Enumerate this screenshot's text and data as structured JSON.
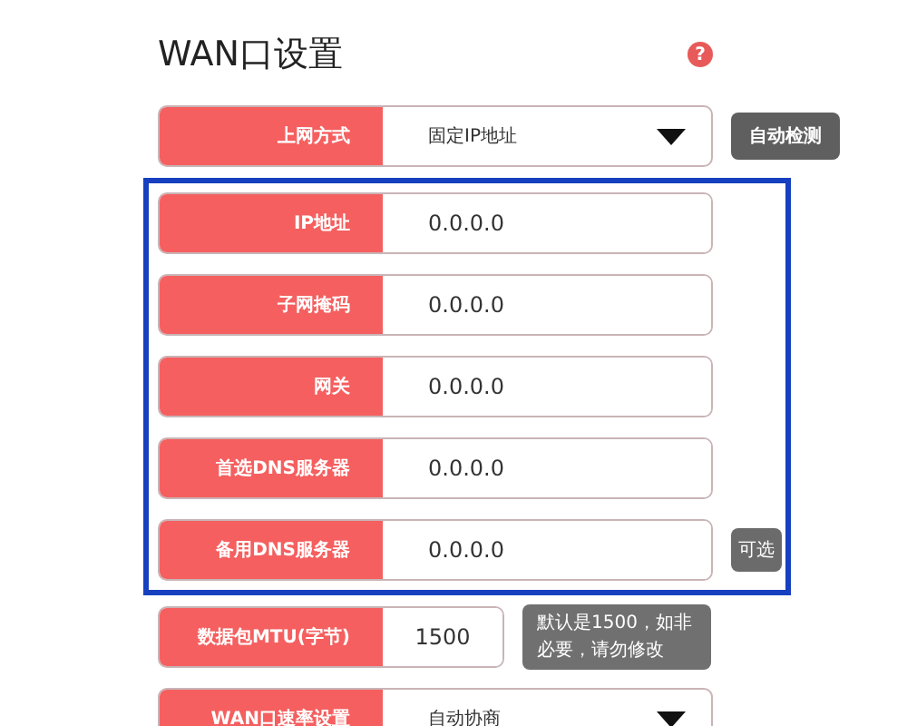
{
  "title": "WAN口设置",
  "help_icon": "?",
  "rows": [
    {
      "kind": "select",
      "label": "上网方式",
      "value": "固定IP地址",
      "action": "自动检测",
      "group": false
    },
    {
      "kind": "input",
      "label": "IP地址",
      "value": "0.0.0.0",
      "group": true
    },
    {
      "kind": "input",
      "label": "子网掩码",
      "value": "0.0.0.0",
      "group": true
    },
    {
      "kind": "input",
      "label": "网关",
      "value": "0.0.0.0",
      "group": true
    },
    {
      "kind": "input",
      "label": "首选DNS服务器",
      "value": "0.0.0.0",
      "group": true
    },
    {
      "kind": "input",
      "label": "备用DNS服务器",
      "value": "0.0.0.0",
      "note": "可选",
      "group": true
    },
    {
      "kind": "short",
      "label": "数据包MTU(字节)",
      "value": "1500",
      "hint": "默认是1500，如非必要，请勿修改",
      "group": false
    },
    {
      "kind": "select",
      "label": "WAN口速率设置",
      "value": "自动协商",
      "group": false
    }
  ]
}
